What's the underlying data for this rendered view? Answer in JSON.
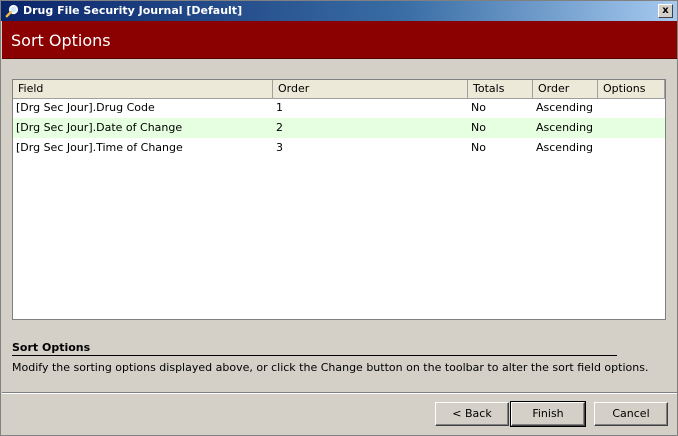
{
  "window": {
    "title": "Drug File Security Journal [Default]",
    "close_glyph": "x"
  },
  "header": {
    "title": "Sort Options"
  },
  "grid": {
    "columns": [
      "Field",
      "Order",
      "Totals",
      "Order",
      "Options"
    ],
    "rows": [
      {
        "field": "[Drg Sec Jour].Drug Code",
        "order": "1",
        "totals": "No",
        "sort_order": "Ascending",
        "options": ""
      },
      {
        "field": "[Drg Sec Jour].Date of Change",
        "order": "2",
        "totals": "No",
        "sort_order": "Ascending",
        "options": ""
      },
      {
        "field": "[Drg Sec Jour].Time of Change",
        "order": "3",
        "totals": "No",
        "sort_order": "Ascending",
        "options": ""
      }
    ]
  },
  "info": {
    "title": "Sort Options",
    "text": "Modify the sorting options displayed above, or click the Change button on the toolbar to alter the sort field options."
  },
  "buttons": {
    "back": "< Back",
    "finish": "Finish",
    "cancel": "Cancel"
  },
  "colors": {
    "header_band": "#8b0000",
    "alt_row": "#e6ffe0"
  },
  "icons": {
    "title_icon": "magnifier-icon"
  }
}
